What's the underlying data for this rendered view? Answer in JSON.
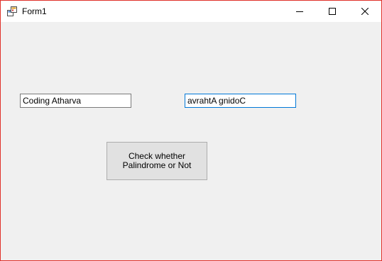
{
  "window": {
    "title": "Form1",
    "icon": "winforms-app-icon",
    "border_color": "#e0312a"
  },
  "caption_buttons": {
    "minimize": "minimize-icon",
    "maximize": "maximize-icon",
    "close": "close-icon"
  },
  "form": {
    "input_text": "Coding Atharva",
    "output_text": "avrahtA gnidoC",
    "check_button_label": "Check whether Palindrome or Not"
  }
}
